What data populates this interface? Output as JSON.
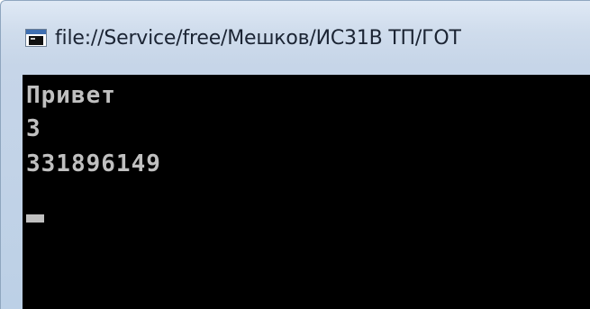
{
  "window": {
    "title": "file://Service/free/Мешков/ИС31В ТП/ГОТ",
    "icon": "console-window-icon"
  },
  "console": {
    "lines": [
      "Привет",
      "3",
      "331896149"
    ],
    "cursor": "blinking-underscore-cursor"
  },
  "colors": {
    "console_background": "#000000",
    "console_text": "#c0c0c0",
    "titlebar": "#cfdcec"
  }
}
